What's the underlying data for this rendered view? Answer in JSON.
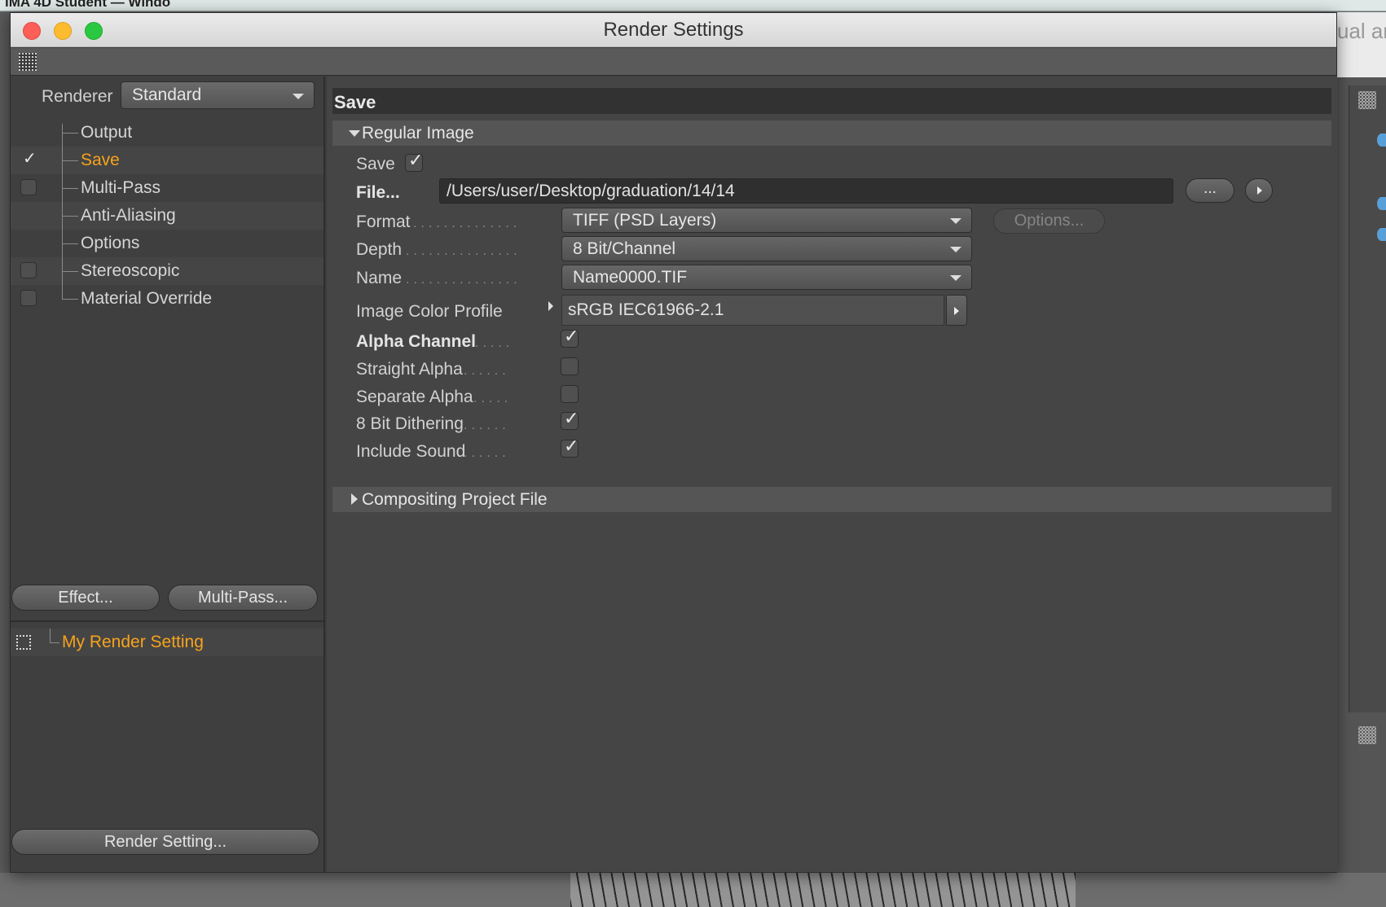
{
  "menubar": {
    "text": "ıMA 4D Student — Windo"
  },
  "background": {
    "right_title_fragment": "ual ar"
  },
  "window": {
    "title": "Render Settings"
  },
  "left": {
    "renderer_label": "Renderer",
    "renderer_value": "Standard",
    "tree": [
      {
        "label": "Output",
        "check": "none",
        "active": false
      },
      {
        "label": "Save",
        "check": "checked",
        "active": true
      },
      {
        "label": "Multi-Pass",
        "check": "unchecked",
        "active": false
      },
      {
        "label": "Anti-Aliasing",
        "check": "none",
        "active": false
      },
      {
        "label": "Options",
        "check": "none",
        "active": false
      },
      {
        "label": "Stereoscopic",
        "check": "unchecked",
        "active": false
      },
      {
        "label": "Material Override",
        "check": "unchecked",
        "active": false
      }
    ],
    "effect_btn": "Effect...",
    "multipass_btn": "Multi-Pass...",
    "preset_name": "My Render Setting",
    "render_setting_btn": "Render Setting..."
  },
  "right": {
    "section_title": "Save",
    "regular_image": {
      "title": "Regular Image",
      "save_label": "Save",
      "save_checked": true,
      "file_label": "File...",
      "file_path": "/Users/user/Desktop/graduation/14/14",
      "browse_btn": "...",
      "format_label": "Format",
      "format_value": "TIFF (PSD Layers)",
      "options_btn": "Options...",
      "depth_label": "Depth",
      "depth_value": "8 Bit/Channel",
      "name_label": "Name",
      "name_value": "Name0000.TIF",
      "profile_label": "Image Color Profile",
      "profile_value": "sRGB IEC61966-2.1",
      "alpha_channel_label": "Alpha Channel",
      "alpha_channel": true,
      "straight_alpha_label": "Straight Alpha",
      "straight_alpha": false,
      "separate_alpha_label": "Separate Alpha",
      "separate_alpha": false,
      "dithering_label": "8 Bit Dithering",
      "dithering": true,
      "sound_label": "Include Sound",
      "sound": true
    },
    "compositing_title": "Compositing Project File"
  },
  "colors": {
    "accent": "#f7a31c",
    "close": "#fc5f57",
    "minimize": "#fdbc2e",
    "maximize": "#2ac840"
  },
  "icons": {
    "checkmark": "✓",
    "panel_grip": "grip-icon",
    "preset": "preset-icon"
  }
}
